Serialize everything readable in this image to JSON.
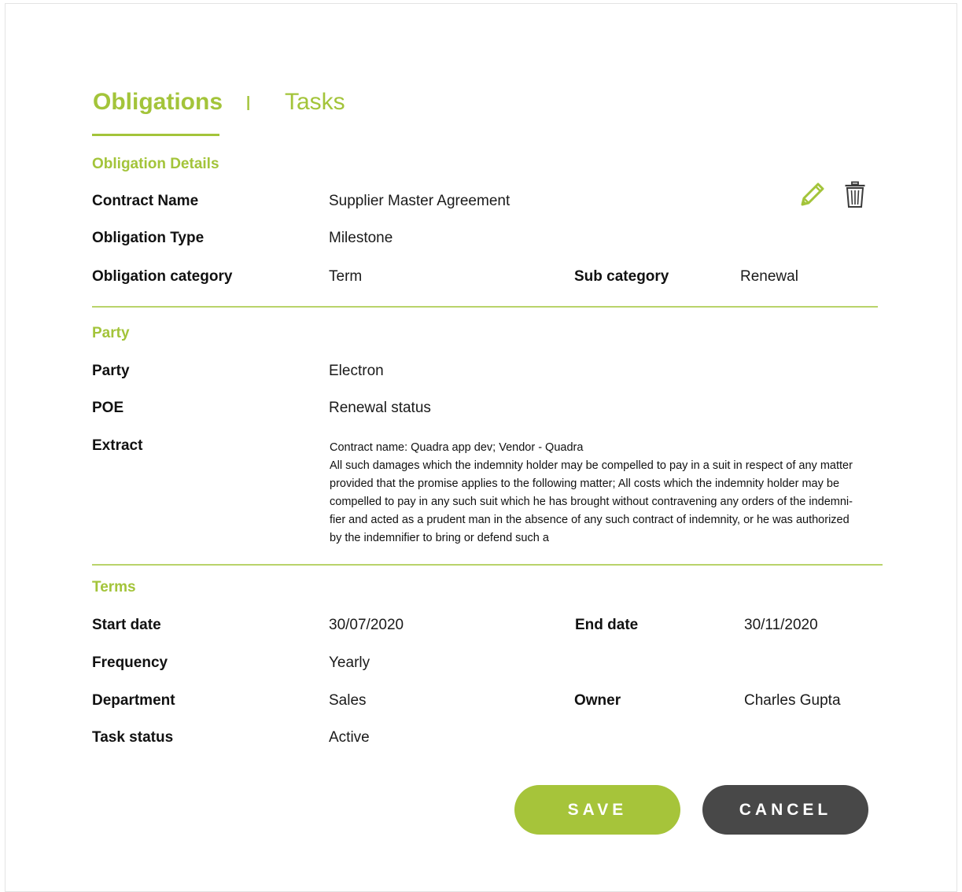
{
  "tabs": {
    "obligations": "Obligations",
    "separator": "I",
    "tasks": "Tasks"
  },
  "sections": {
    "details": {
      "title": "Obligation Details",
      "contract_name_label": "Contract Name",
      "contract_name_value": "Supplier Master Agreement",
      "obligation_type_label": "Obligation Type",
      "obligation_type_value": "Milestone",
      "obligation_category_label": "Obligation category",
      "obligation_category_value": "Term",
      "sub_category_label": "Sub category",
      "sub_category_value": "Renewal"
    },
    "party": {
      "title": "Party",
      "party_label": "Party",
      "party_value": "Electron",
      "poe_label": "POE",
      "poe_value": "Renewal status",
      "extract_label": "Extract",
      "extract_lines": [
        "Contract name: Quadra app dev; Vendor - Quadra",
        "All such damages which the indemnity holder may be compelled to pay in a suit in respect of any matter",
        "provided that the promise applies to the following matter; All costs which the indemnity holder may be",
        "compelled to pay in any such suit which he has brought without contravening any orders of the indemni-",
        "fier and acted as a prudent man in the absence of any such contract of indemnity, or he was authorized",
        "by the indemnifier to bring or defend such a"
      ]
    },
    "terms": {
      "title": "Terms",
      "start_date_label": "Start date",
      "start_date_value": "30/07/2020",
      "end_date_label": "End date",
      "end_date_value": "30/11/2020",
      "frequency_label": "Frequency",
      "frequency_value": "Yearly",
      "department_label": "Department",
      "department_value": "Sales",
      "owner_label": "Owner",
      "owner_value": "Charles Gupta",
      "task_status_label": "Task status",
      "task_status_value": "Active"
    }
  },
  "actions": {
    "save_label": "SAVE",
    "cancel_label": "CANCEL"
  },
  "icons": {
    "edit": "pencil-icon",
    "delete": "trash-icon"
  },
  "colors": {
    "accent": "#a3c43a",
    "cancel": "#484848",
    "panel_bg": "#f4f5f6"
  }
}
